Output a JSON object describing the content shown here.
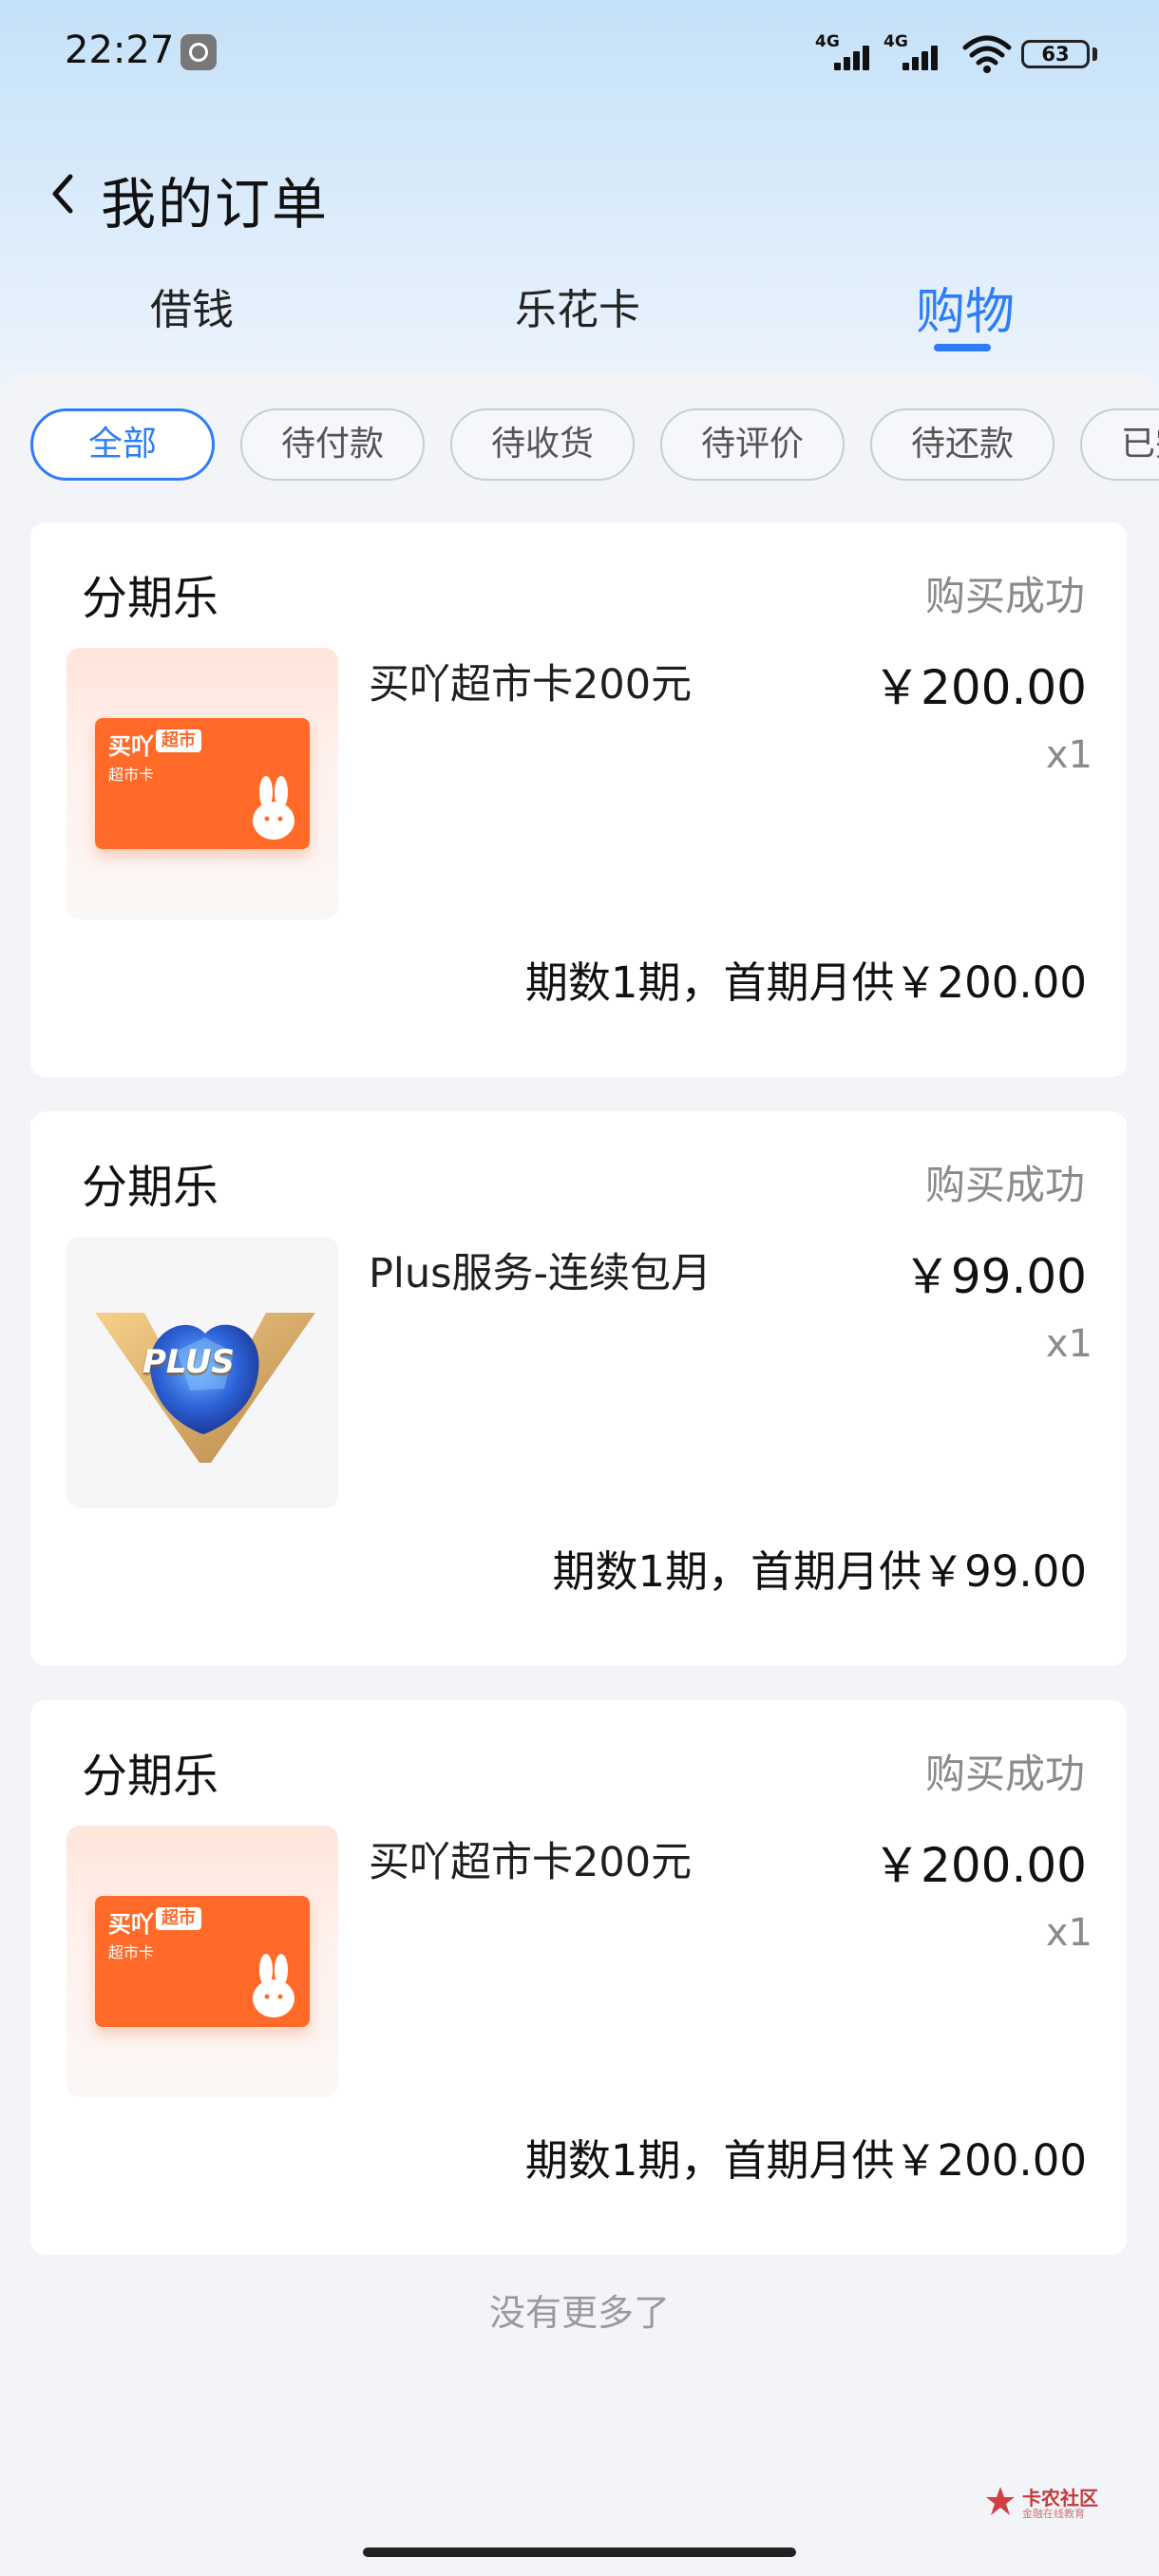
{
  "status_bar": {
    "time": "22:27",
    "network_1": "4G",
    "network_2": "4G",
    "battery": "63"
  },
  "header": {
    "title": "我的订单"
  },
  "tabs": [
    {
      "label": "借钱"
    },
    {
      "label": "乐花卡"
    },
    {
      "label": "购物",
      "active": true
    }
  ],
  "filters": [
    {
      "label": "全部",
      "active": true
    },
    {
      "label": "待付款"
    },
    {
      "label": "待收货"
    },
    {
      "label": "待评价"
    },
    {
      "label": "待还款"
    },
    {
      "label": "已完成"
    }
  ],
  "orders": [
    {
      "merchant": "分期乐",
      "status": "购买成功",
      "product": "买吖超市卡200元",
      "price": "￥200.00",
      "qty": "x1",
      "installment": "期数1期，首期月供￥200.00",
      "thumb": {
        "type": "gift-card",
        "brand": "买吖",
        "tag": "超市",
        "sub": "超市卡"
      }
    },
    {
      "merchant": "分期乐",
      "status": "购买成功",
      "product": "Plus服务-连续包月",
      "price": "￥99.00",
      "qty": "x1",
      "installment": "期数1期，首期月供￥99.00",
      "thumb": {
        "type": "plus-badge",
        "text": "PLUS"
      }
    },
    {
      "merchant": "分期乐",
      "status": "购买成功",
      "product": "买吖超市卡200元",
      "price": "￥200.00",
      "qty": "x1",
      "installment": "期数1期，首期月供￥200.00",
      "thumb": {
        "type": "gift-card",
        "brand": "买吖",
        "tag": "超市",
        "sub": "超市卡"
      }
    }
  ],
  "footer": {
    "end_text": "没有更多了"
  },
  "watermark": {
    "text": "卡农社区",
    "sub": "金融在线教育"
  },
  "colors": {
    "accent": "#2f7df6",
    "card_orange": "#ff6a28",
    "muted": "#8a8a8a"
  }
}
